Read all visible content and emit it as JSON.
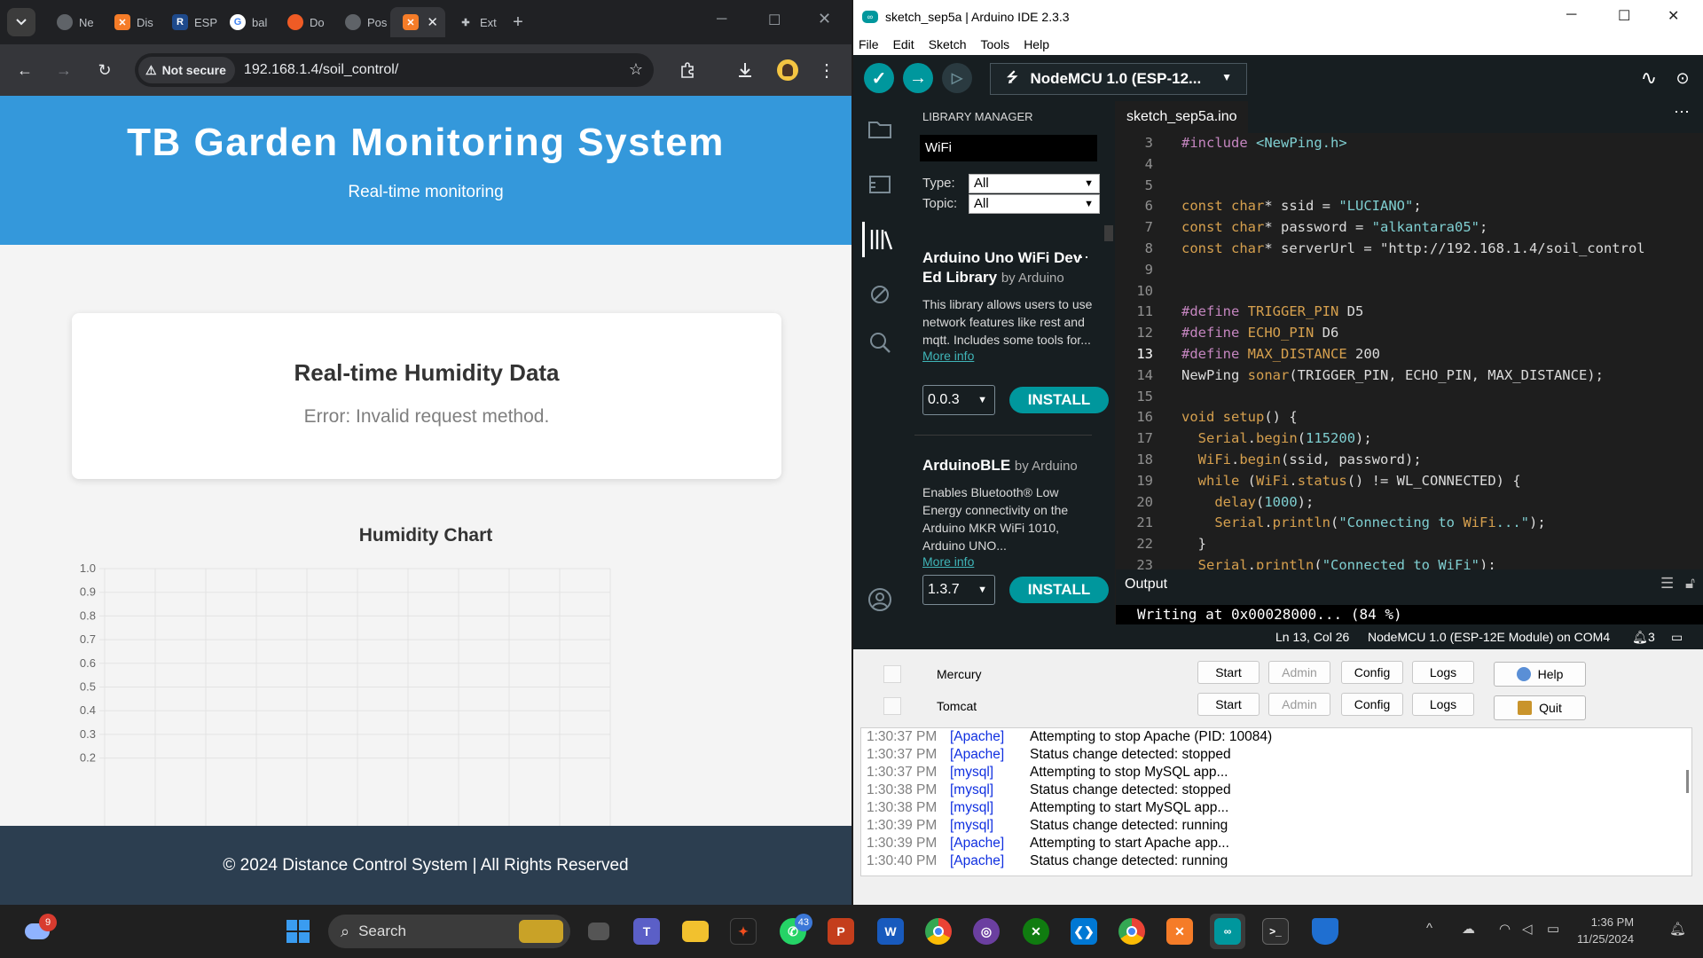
{
  "browser": {
    "tabs": [
      {
        "label": "Ne",
        "icon": "chrome-icon",
        "color": "#5f6368"
      },
      {
        "label": "Dis",
        "icon": "xampp-icon",
        "color": "#f57c28"
      },
      {
        "label": "ESP",
        "icon": "r-icon",
        "color": "#1e4a8c"
      },
      {
        "label": "bal",
        "icon": "google-icon",
        "color": "#ffffff"
      },
      {
        "label": "Do",
        "icon": "postman-icon",
        "color": "#ef5b25"
      },
      {
        "label": "Pos",
        "icon": "globe-icon",
        "color": "#5f6368"
      },
      {
        "label": "",
        "icon": "xampp-icon",
        "color": "#f57c28"
      },
      {
        "label": "Ext",
        "icon": "puzzle-icon",
        "color": "#5f6368"
      }
    ],
    "security_label": "Not secure",
    "url": "192.168.1.4/soil_control/"
  },
  "site": {
    "title": "TB Garden Monitoring System",
    "subtitle": "Real-time monitoring",
    "card_title": "Real-time Humidity Data",
    "card_message": "Error: Invalid request method.",
    "chart_title": "Humidity Chart",
    "footer": "© 2024 Distance Control System | All Rights Reserved"
  },
  "chart_data": {
    "type": "line",
    "title": "Humidity Chart",
    "x": [],
    "series": [],
    "ylim": [
      0.2,
      1.0
    ],
    "yticks": [
      "1.0",
      "0.9",
      "0.8",
      "0.7",
      "0.6",
      "0.5",
      "0.4",
      "0.3",
      "0.2"
    ],
    "grid": true,
    "vertical_gridlines": 11
  },
  "ide": {
    "title": "sketch_sep5a | Arduino IDE 2.3.3",
    "menu": [
      "File",
      "Edit",
      "Sketch",
      "Tools",
      "Help"
    ],
    "board": "NodeMCU 1.0 (ESP-12...",
    "library_header": "LIBRARY MANAGER",
    "search_value": "WiFi",
    "type_label": "Type:",
    "type_value": "All",
    "topic_label": "Topic:",
    "topic_value": "All",
    "libraries": [
      {
        "name_line1": "Arduino Uno WiFi Dev",
        "name_line2": "Ed Library",
        "by": "by Arduino",
        "description": "This library allows users to use network features like rest and mqtt. Includes some tools for...",
        "more": "More info",
        "version": "0.0.3",
        "install": "INSTALL"
      },
      {
        "name_line1": "ArduinoBLE",
        "name_line2": "",
        "by": "by Arduino",
        "description": "Enables Bluetooth® Low Energy connectivity on the Arduino MKR WiFi 1010, Arduino UNO...",
        "more": "More info",
        "version": "1.3.7",
        "install": "INSTALL"
      }
    ],
    "file_tab": "sketch_sep5a.ino",
    "code_lines": [
      {
        "n": "3",
        "t": "#include <NewPing.h>"
      },
      {
        "n": "4",
        "t": ""
      },
      {
        "n": "5",
        "t": ""
      },
      {
        "n": "6",
        "t": "const char* ssid = \"LUCIANO\";"
      },
      {
        "n": "7",
        "t": "const char* password = \"alkantara05\";"
      },
      {
        "n": "8",
        "t": "const char* serverUrl = \"http://192.168.1.4/soil_control"
      },
      {
        "n": "9",
        "t": ""
      },
      {
        "n": "10",
        "t": ""
      },
      {
        "n": "11",
        "t": "#define TRIGGER_PIN D5"
      },
      {
        "n": "12",
        "t": "#define ECHO_PIN D6"
      },
      {
        "n": "13",
        "t": "#define MAX_DISTANCE 200"
      },
      {
        "n": "14",
        "t": "NewPing sonar(TRIGGER_PIN, ECHO_PIN, MAX_DISTANCE);"
      },
      {
        "n": "15",
        "t": ""
      },
      {
        "n": "16",
        "t": "void setup() {"
      },
      {
        "n": "17",
        "t": "  Serial.begin(115200);"
      },
      {
        "n": "18",
        "t": "  WiFi.begin(ssid, password);"
      },
      {
        "n": "19",
        "t": "  while (WiFi.status() != WL_CONNECTED) {"
      },
      {
        "n": "20",
        "t": "    delay(1000);"
      },
      {
        "n": "21",
        "t": "    Serial.println(\"Connecting to WiFi...\");"
      },
      {
        "n": "22",
        "t": "  }"
      },
      {
        "n": "23",
        "t": "  Serial.println(\"Connected to WiFi\");"
      }
    ],
    "output_label": "Output",
    "output_text": "Writing at 0x00028000... (84 %)",
    "status_position": "Ln 13, Col 26",
    "status_board": "NodeMCU 1.0 (ESP-12E Module) on COM4",
    "status_count": "3"
  },
  "xampp": {
    "modules": [
      {
        "name": "Mercury",
        "start": "Start",
        "admin": "Admin",
        "config": "Config",
        "logs": "Logs"
      },
      {
        "name": "Tomcat",
        "start": "Start",
        "admin": "Admin",
        "config": "Config",
        "logs": "Logs"
      }
    ],
    "help": "Help",
    "quit": "Quit",
    "log": [
      {
        "time": "1:30:37 PM",
        "module": "[Apache]",
        "msg": "Attempting to stop Apache (PID: 10084)"
      },
      {
        "time": "1:30:37 PM",
        "module": "[Apache]",
        "msg": "Status change detected: stopped"
      },
      {
        "time": "1:30:37 PM",
        "module": "[mysql]",
        "msg": "Attempting to stop MySQL app..."
      },
      {
        "time": "1:30:38 PM",
        "module": "[mysql]",
        "msg": "Status change detected: stopped"
      },
      {
        "time": "1:30:38 PM",
        "module": "[mysql]",
        "msg": "Attempting to start MySQL app..."
      },
      {
        "time": "1:30:39 PM",
        "module": "[mysql]",
        "msg": "Status change detected: running"
      },
      {
        "time": "1:30:39 PM",
        "module": "[Apache]",
        "msg": "Attempting to start Apache app..."
      },
      {
        "time": "1:30:40 PM",
        "module": "[Apache]",
        "msg": "Status change detected: running"
      }
    ]
  },
  "taskbar": {
    "weather_badge": "9",
    "search_placeholder": "Search",
    "whatsapp_badge": "43",
    "time": "1:36 PM",
    "date": "11/25/2024"
  }
}
